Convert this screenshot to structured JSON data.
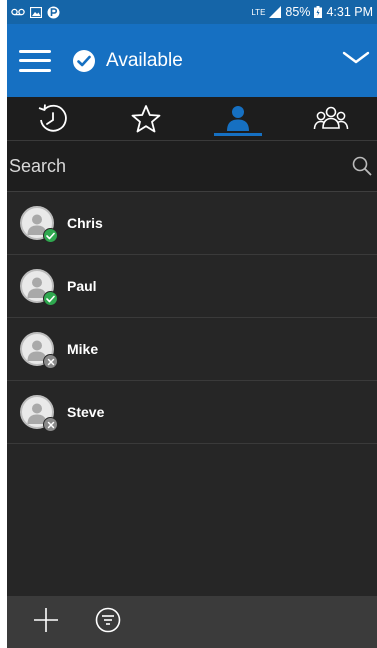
{
  "status_bar": {
    "network_type": "LTE",
    "battery": "85%",
    "time": "4:31 PM"
  },
  "header": {
    "presence": "Available"
  },
  "tabs": [
    {
      "name": "recent",
      "icon": "history-icon",
      "active": false
    },
    {
      "name": "favorites",
      "icon": "star-icon",
      "active": false
    },
    {
      "name": "contacts",
      "icon": "person-icon",
      "active": true
    },
    {
      "name": "groups",
      "icon": "group-icon",
      "active": false
    }
  ],
  "search": {
    "placeholder": "Search"
  },
  "contacts": [
    {
      "name": "Chris",
      "status": "available"
    },
    {
      "name": "Paul",
      "status": "available"
    },
    {
      "name": "Mike",
      "status": "offline"
    },
    {
      "name": "Steve",
      "status": "offline"
    }
  ],
  "colors": {
    "status_bar": "#1565a8",
    "header": "#1670c2",
    "background": "#262626",
    "available": "#2fa84f",
    "offline": "#8a8a8a"
  }
}
